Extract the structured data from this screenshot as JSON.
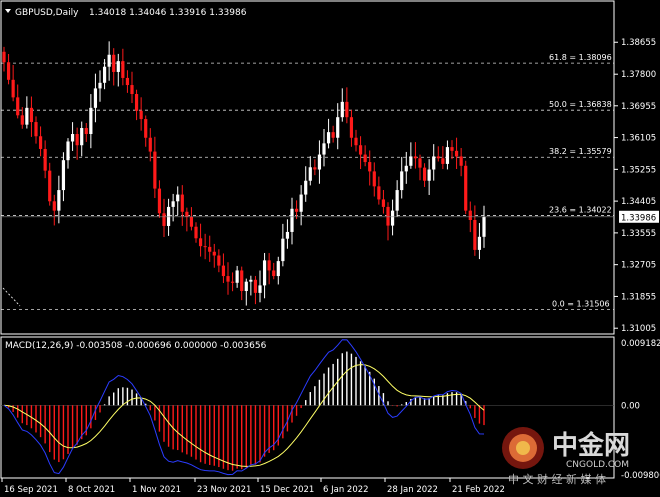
{
  "header": {
    "symbol": "GBPUSD,Daily",
    "ohlc": "1.34018 1.34046 1.33916 1.33986"
  },
  "macd_header": "MACD(12,26,9) -0.003508 -0.000696 0.000000 -0.003656",
  "fib_levels": [
    {
      "label": "61.8 = 1.38096",
      "value": 1.38096
    },
    {
      "label": "50.0 = 1.36838",
      "value": 1.36838
    },
    {
      "label": "38.2 = 1.35579",
      "value": 1.35579
    },
    {
      "label": "23.6 = 1.34022",
      "value": 1.34022
    },
    {
      "label": "0.0 = 1.31506",
      "value": 1.31506
    }
  ],
  "price_axis": {
    "ticks": [
      "1.38655",
      "1.37800",
      "1.36955",
      "1.36105",
      "1.35255",
      "1.34405",
      "1.33555",
      "1.32705",
      "1.31855",
      "1.31005"
    ],
    "tick_values": [
      1.38655,
      1.378,
      1.36955,
      1.36105,
      1.35255,
      1.34405,
      1.33555,
      1.32705,
      1.31855,
      1.31005
    ],
    "current_price": "1.33986",
    "current_value": 1.33986
  },
  "macd_axis": {
    "ticks": [
      "0.009182",
      "0.00",
      "-0.009806"
    ],
    "tick_values": [
      0.009182,
      0.0,
      -0.009806
    ]
  },
  "time_axis": {
    "labels": [
      "16 Sep 2021",
      "8 Oct 2021",
      "1 Nov 2021",
      "23 Nov 2021",
      "15 Dec 2021",
      "6 Jan 2022",
      "28 Jan 2022",
      "21 Feb 2022"
    ]
  },
  "watermark": {
    "cn": "中金网",
    "en": "CNGOLD.COM",
    "sub": "中 文 财 经 新 媒 体"
  },
  "chart_data": {
    "type": "candlestick",
    "symbol": "GBPUSD",
    "timeframe": "Daily",
    "price_range": [
      1.3085,
      1.3925
    ],
    "closes": [
      1.3812,
      1.3765,
      1.3718,
      1.367,
      1.3645,
      1.369,
      1.3652,
      1.3614,
      1.358,
      1.3522,
      1.344,
      1.3415,
      1.347,
      1.355,
      1.36,
      1.362,
      1.359,
      1.3636,
      1.362,
      1.369,
      1.3742,
      1.3757,
      1.38,
      1.3832,
      1.3786,
      1.3815,
      1.377,
      1.3751,
      1.3727,
      1.3682,
      1.366,
      1.361,
      1.3573,
      1.3474,
      1.3408,
      1.3374,
      1.3425,
      1.344,
      1.3458,
      1.3412,
      1.3398,
      1.3372,
      1.3341,
      1.332,
      1.3318,
      1.3305,
      1.3295,
      1.3268,
      1.324,
      1.3225,
      1.3222,
      1.3255,
      1.32,
      1.3225,
      1.323,
      1.3195,
      1.3215,
      1.3282,
      1.3255,
      1.324,
      1.328,
      1.334,
      1.3358,
      1.342,
      1.3412,
      1.3458,
      1.3495,
      1.3531,
      1.3525,
      1.3565,
      1.3595,
      1.3625,
      1.361,
      1.3665,
      1.3706,
      1.3665,
      1.361,
      1.359,
      1.3565,
      1.3545,
      1.352,
      1.348,
      1.3445,
      1.3425,
      1.3375,
      1.3415,
      1.347,
      1.352,
      1.3535,
      1.356,
      1.3555,
      1.353,
      1.3495,
      1.3525,
      1.356,
      1.3555,
      1.354,
      1.3585,
      1.3575,
      1.356,
      1.3535,
      1.3415,
      1.339,
      1.331,
      1.3345,
      1.3398
    ],
    "macd_series": [
      {
        "name": "MACD",
        "type": "histogram"
      },
      {
        "name": "Signal",
        "type": "line"
      }
    ],
    "macd_range": [
      -0.009806,
      0.009182
    ]
  }
}
